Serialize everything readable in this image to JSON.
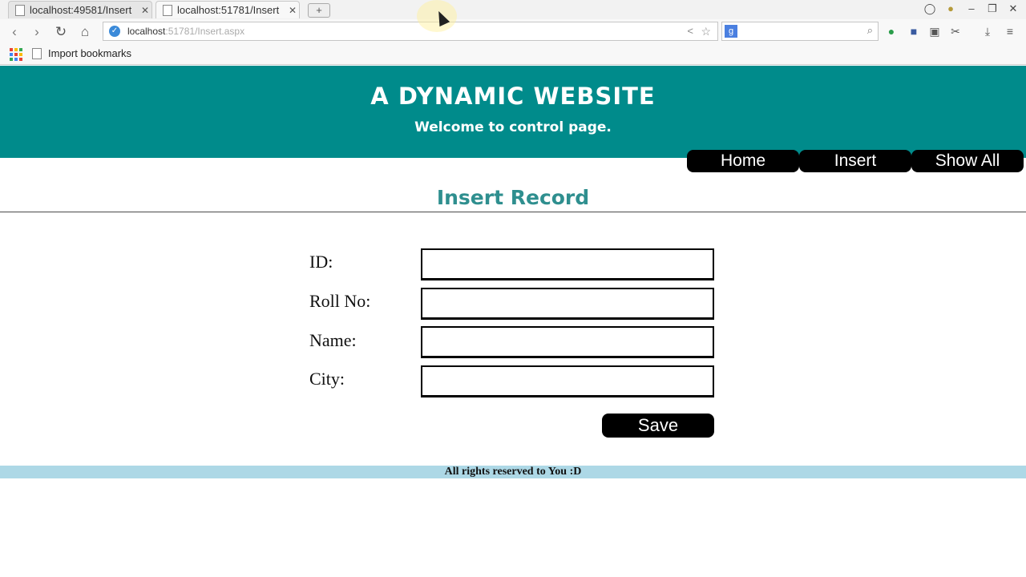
{
  "browser": {
    "tabs": [
      {
        "title": "localhost:49581/Insert",
        "active": false
      },
      {
        "title": "localhost:51781/Insert",
        "active": true
      }
    ],
    "new_tab": "+",
    "address": {
      "host": "localhost",
      "path": ":51781/Insert.aspx"
    },
    "search_engine": "g",
    "bookmark": "Import bookmarks",
    "icons": [
      "back-icon",
      "forward-icon",
      "reload-icon",
      "home-icon",
      "secure-icon",
      "share-icon",
      "star-icon",
      "search-icon",
      "menu-icon"
    ]
  },
  "header": {
    "title": "A DYNAMIC WEBSITE",
    "subtitle": "Welcome to control page."
  },
  "menu": {
    "items": [
      "Home",
      "Insert",
      "Show All"
    ]
  },
  "form": {
    "title": "Insert Record",
    "fields": [
      {
        "label": "ID:",
        "value": ""
      },
      {
        "label": "Roll No:",
        "value": ""
      },
      {
        "label": "Name:",
        "value": ""
      },
      {
        "label": "City:",
        "value": ""
      }
    ],
    "save_label": "Save"
  },
  "footer": {
    "text": "All rights reserved to You :D"
  },
  "colors": {
    "header_bg": "#008b8b",
    "section_title": "#2f8f8f",
    "footer_bg": "#add8e6",
    "button_bg": "#000000"
  }
}
